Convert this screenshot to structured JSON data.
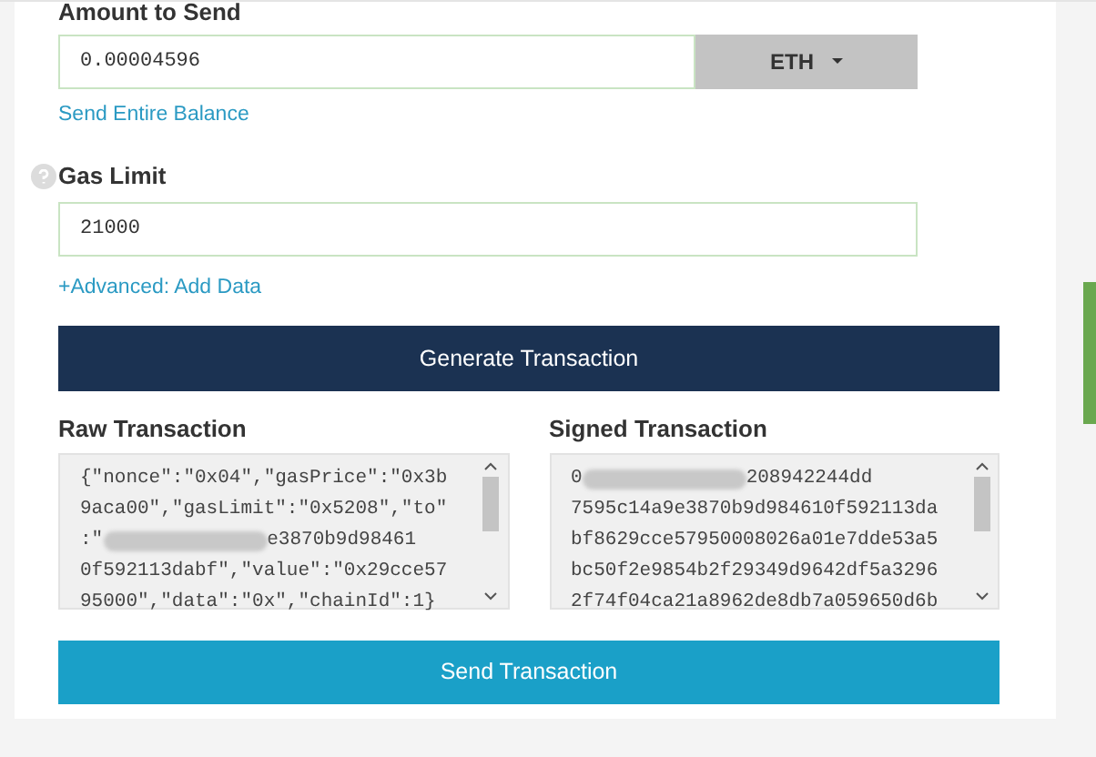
{
  "amount": {
    "label": "Amount to Send",
    "value": "0.00004596",
    "currency": "ETH",
    "link": "Send Entire Balance"
  },
  "gas": {
    "label": "Gas Limit",
    "value": "21000",
    "link": "+Advanced: Add Data"
  },
  "generate_button": "Generate Transaction",
  "raw": {
    "label": "Raw Transaction",
    "lines": [
      {
        "text": "{\"nonce\":\"0x04\",\"gasPrice\":\"0x3b",
        "redacted": false
      },
      {
        "text": "9aca00\",\"gasLimit\":\"0x5208\",\"to\"",
        "redacted": false
      },
      {
        "before": ":\"",
        "text": "e3870b9d98461",
        "redacted": true
      },
      {
        "text": "0f592113dabf\",\"value\":\"0x29cce57",
        "redacted": false
      },
      {
        "text": "95000\",\"data\":\"0x\",\"chainId\":1}",
        "redacted": false
      }
    ]
  },
  "signed": {
    "label": "Signed Transaction",
    "lines": [
      {
        "before": "0",
        "text": "208942244dd",
        "redacted": true
      },
      {
        "text": "7595c14a9e3870b9d984610f592113da",
        "redacted": false
      },
      {
        "text": "bf8629cce57950008026a01e7dde53a5",
        "redacted": false
      },
      {
        "text": "bc50f2e9854b2f29349d9642df5a3296",
        "redacted": false
      },
      {
        "text": "2f74f04ca21a8962de8db7a059650d6b",
        "redacted": false
      }
    ]
  },
  "send_button": "Send Transaction"
}
